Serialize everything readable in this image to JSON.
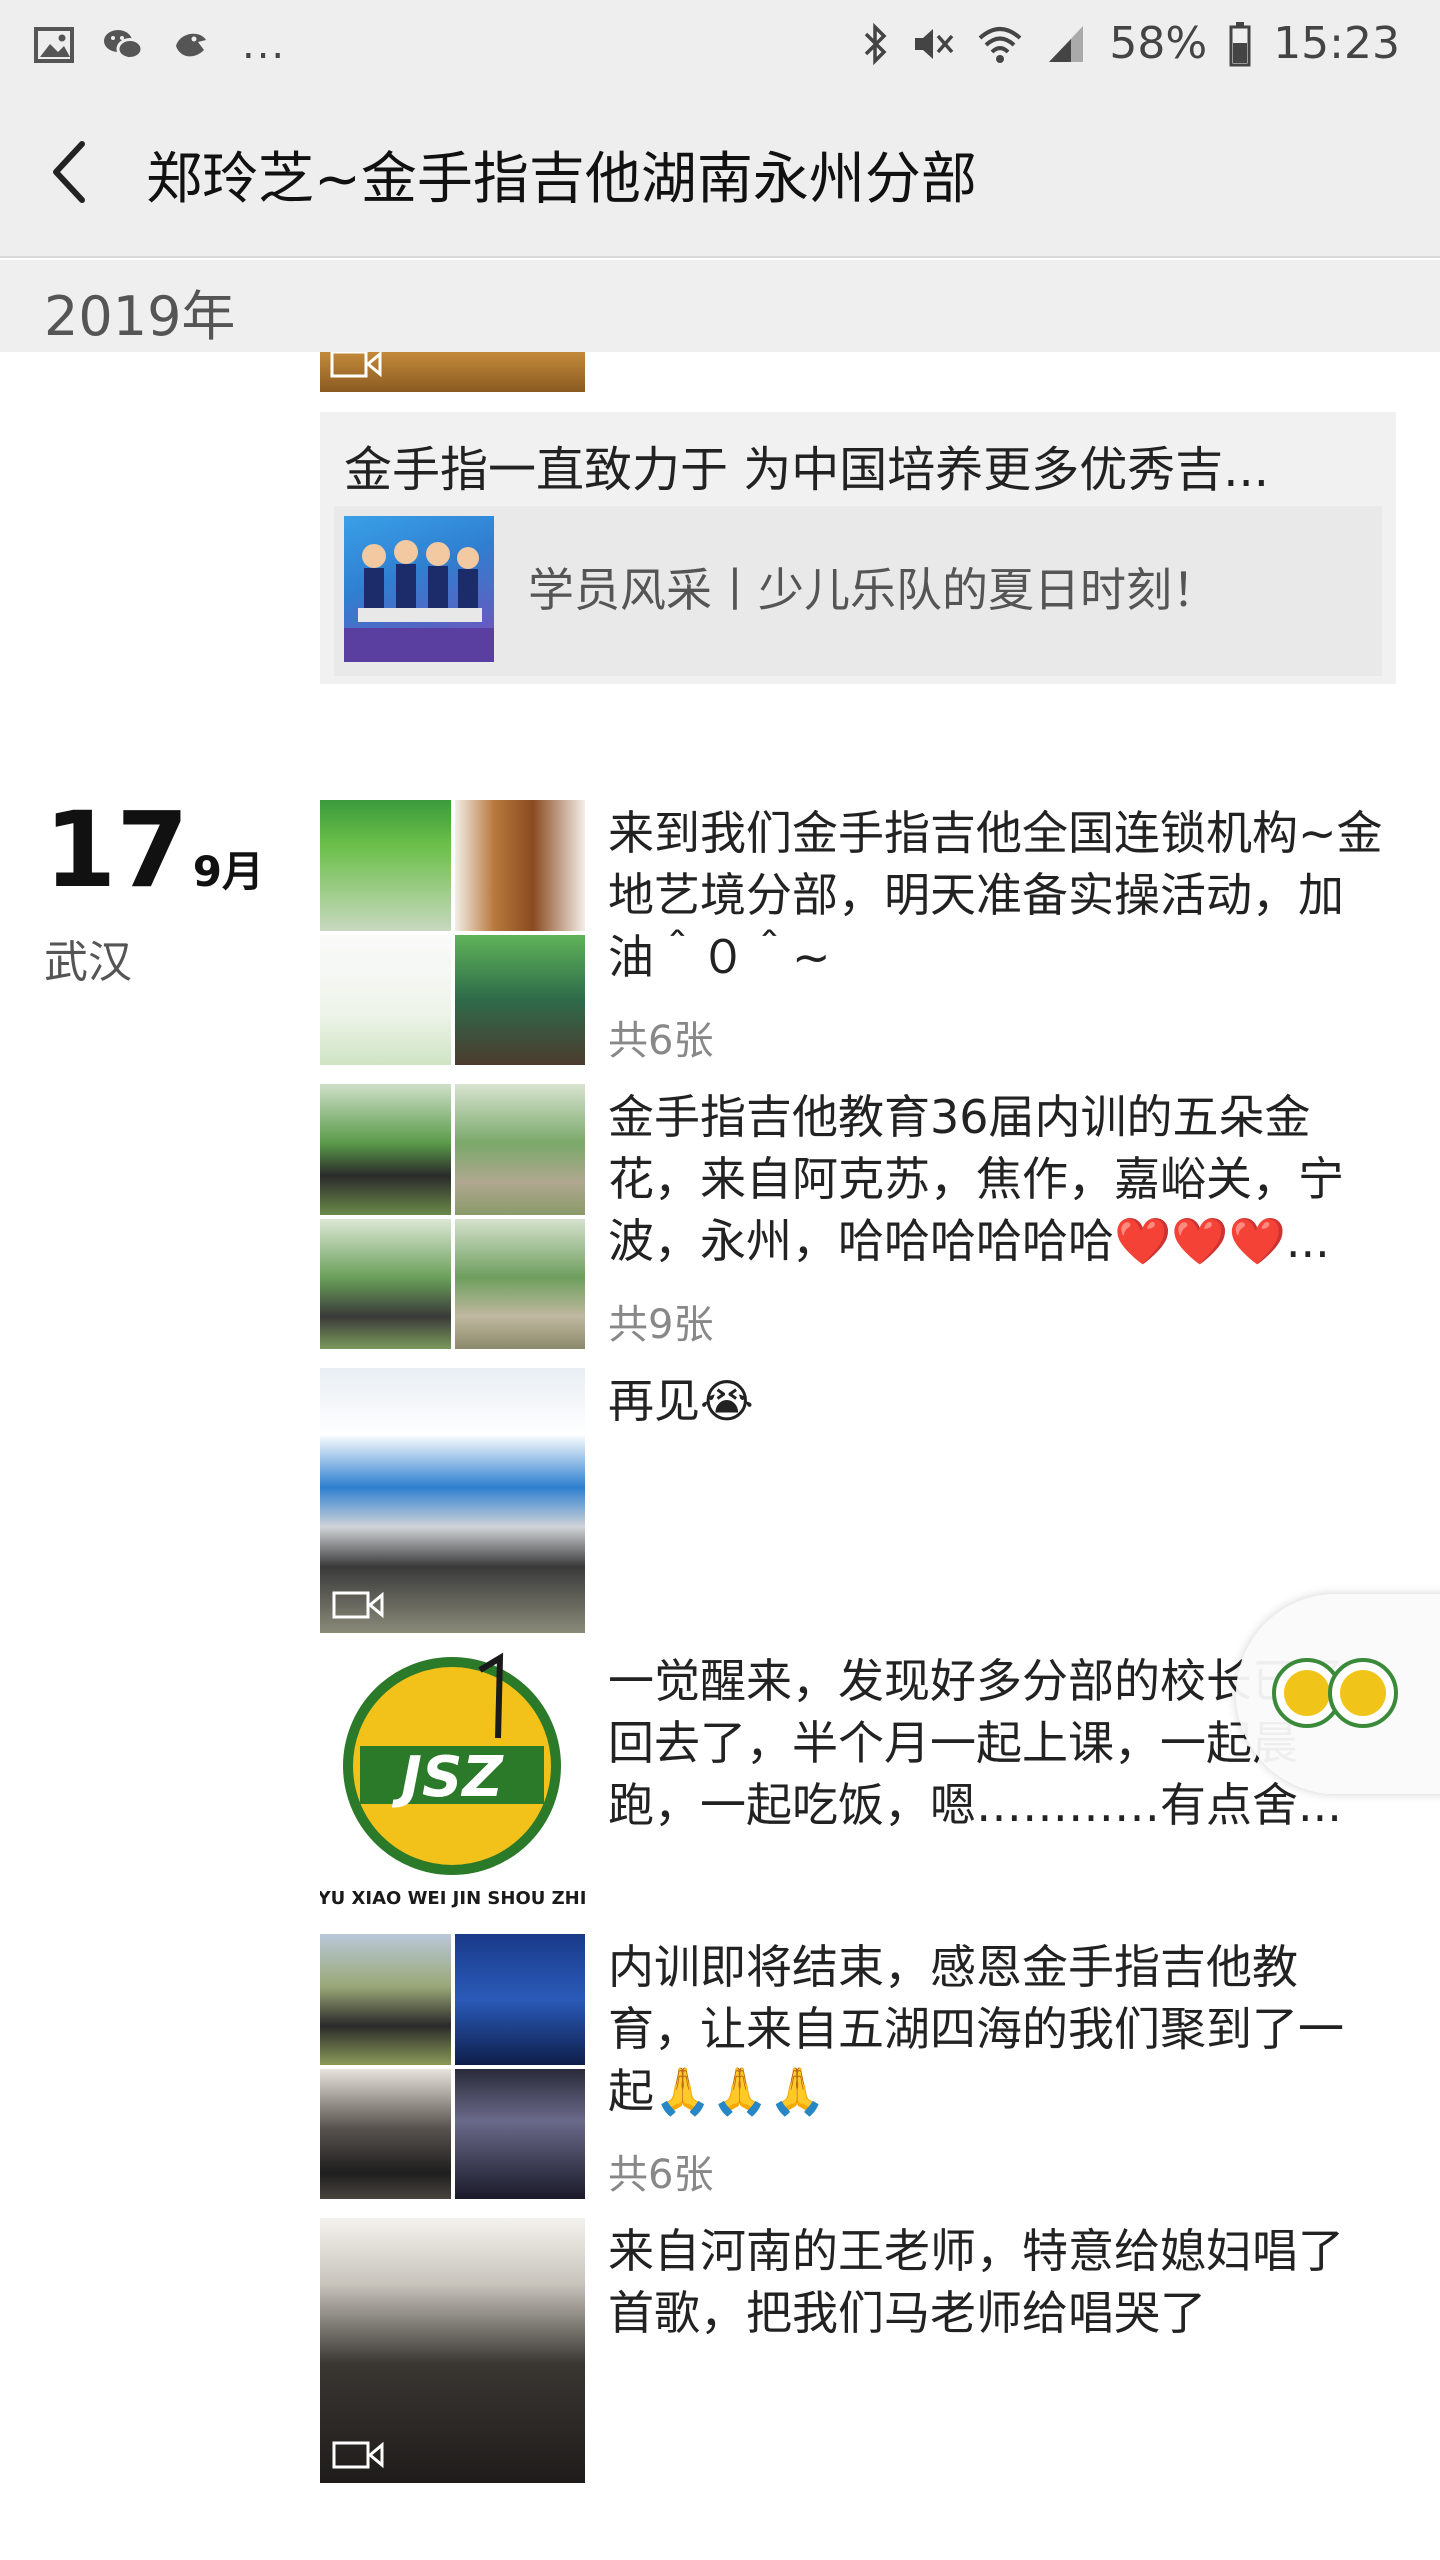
{
  "status_bar": {
    "battery": "58%",
    "time": "15:23",
    "dots": "..."
  },
  "header": {
    "title": "郑玲芝~金手指吉他湖南永州分部"
  },
  "year_bar": {
    "label": "2019年"
  },
  "shared_post": {
    "text": "金手指一直致力于 为中国培养更多优秀吉...",
    "link_title": "学员风采丨少儿乐队的夏日时刻！"
  },
  "date_group": {
    "day": "17",
    "month": "9月",
    "location": "武汉"
  },
  "posts": [
    {
      "text": "来到我们金手指吉他全国连锁机构~金地艺境分部，明天准备实操活动，加油＾０＾~",
      "count": "共6张"
    },
    {
      "text": "金手指吉他教育36届内训的五朵金花，来自阿克苏，焦作，嘉峪关，宁波，永州，哈哈哈哈哈哈❤️❤️❤️...",
      "count": "共9张"
    },
    {
      "text": "再见😭"
    },
    {
      "text": "一觉醒来，发现好多分部的校长已经回去了，半个月一起上课，一起晨跑，一起吃饭，嗯…………有点舍...",
      "logo_letters": "JSZ",
      "logo_slogan": "YU XIAO WEI JIN SHOU ZHI"
    },
    {
      "text": "内训即将结束，感恩金手指吉他教育，让来自五湖四海的我们聚到了一起🙏🙏🙏",
      "count": "共6张"
    },
    {
      "text": "来自河南的王老师，特意给媳妇唱了首歌，把我们马老师给唱哭了"
    }
  ]
}
